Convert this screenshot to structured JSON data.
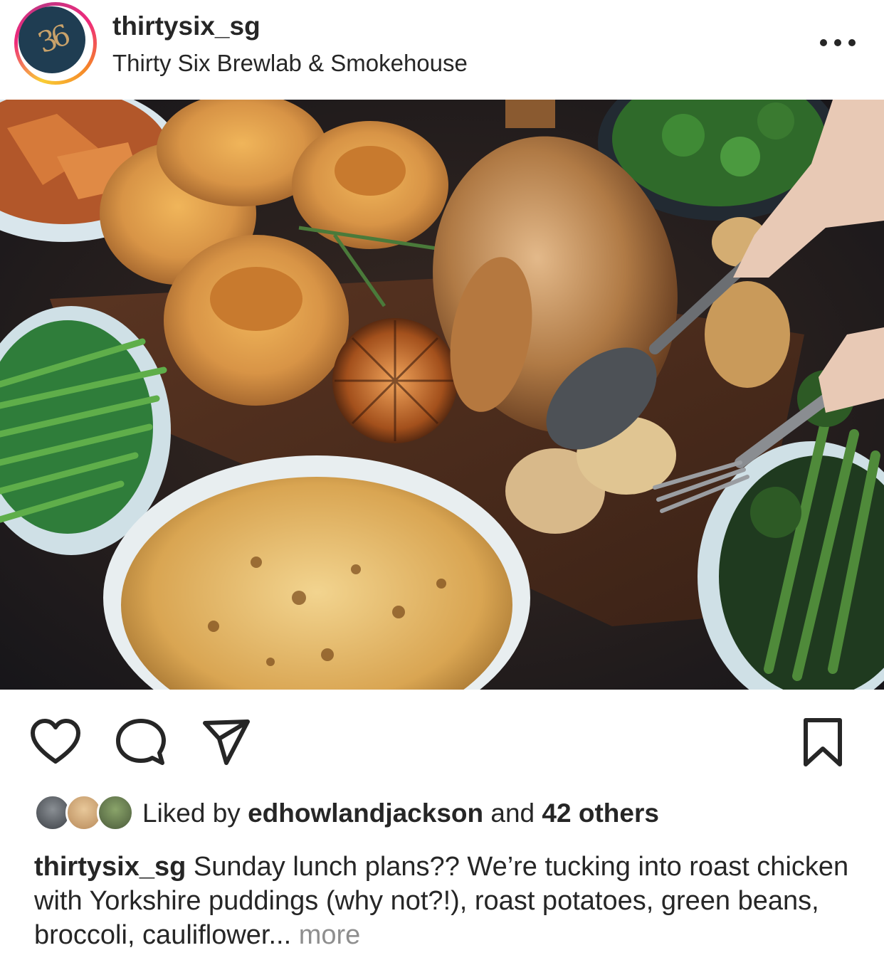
{
  "post": {
    "username": "thirtysix_sg",
    "location": "Thirty Six Brewlab & Smokehouse",
    "avatar_text": "36",
    "more_icon": "ellipsis-icon"
  },
  "actions": {
    "like_icon": "heart-icon",
    "comment_icon": "comment-bubble-icon",
    "share_icon": "paper-plane-icon",
    "save_icon": "bookmark-icon"
  },
  "likes": {
    "prefix": "Liked by",
    "user": "edhowlandjackson",
    "middle": "and",
    "others": "42 others"
  },
  "caption": {
    "username": "thirtysix_sg",
    "text": "Sunday lunch plans?? We’re tucking into roast chicken with Yorkshire puddings (why not?!), roast potatoes, green beans, broccoli, cauliflower...",
    "more": "more"
  },
  "colors": {
    "text": "#262626",
    "muted": "#8e8e8e",
    "avatar_bg": "#1f3d52",
    "avatar_gold": "#c9a26a"
  }
}
